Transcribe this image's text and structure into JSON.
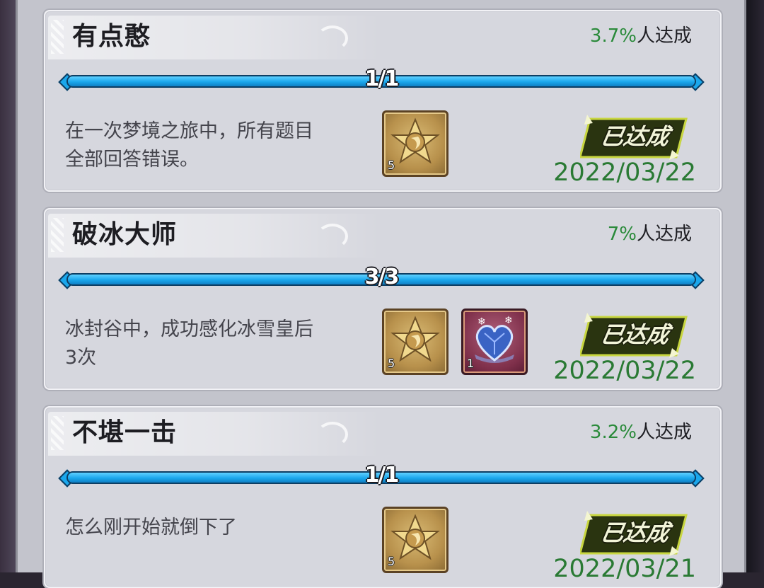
{
  "achievements": [
    {
      "title": "有点憨",
      "percent": "3.7%",
      "percent_label": "人达成",
      "progress_text": "1/1",
      "progress": 1.0,
      "description_line1": "在一次梦境之旅中，所有题目",
      "description_line2": "全部回答错误。",
      "rewards": [
        {
          "icon": "gold-star-badge-icon",
          "qty": "5"
        }
      ],
      "badge": "已达成",
      "date": "2022/03/22"
    },
    {
      "title": "破冰大师",
      "percent": "7%",
      "percent_label": "人达成",
      "progress_text": "3/3",
      "progress": 1.0,
      "description_line1": "冰封谷中，成功感化冰雪皇后",
      "description_line2": "3次",
      "rewards": [
        {
          "icon": "gold-star-badge-icon",
          "qty": "5"
        },
        {
          "icon": "blue-heart-gem-icon",
          "qty": "1"
        }
      ],
      "badge": "已达成",
      "date": "2022/03/22"
    },
    {
      "title": "不堪一击",
      "percent": "3.2%",
      "percent_label": "人达成",
      "progress_text": "1/1",
      "progress": 1.0,
      "description_line1": "怎么刚开始就倒下了",
      "description_line2": "",
      "rewards": [
        {
          "icon": "gold-star-badge-icon",
          "qty": "5"
        }
      ],
      "badge": "已达成",
      "date": "2022/03/21"
    }
  ],
  "colors": {
    "progress": "#1aa7ec",
    "percent": "#2a8a3a",
    "date": "#2a7a34",
    "badge": "#2a3410"
  }
}
